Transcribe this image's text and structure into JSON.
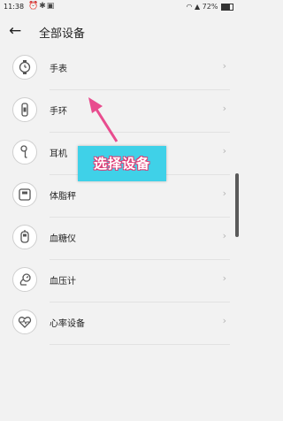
{
  "status_bar": {
    "time": "11:38",
    "right_text": "72%",
    "icons": [
      "alarm-icon",
      "bluetooth-icon",
      "app-notification-icon",
      "wifi-icon",
      "signal-icon",
      "battery-icon"
    ]
  },
  "header": {
    "back_icon": "←",
    "title": "全部设备"
  },
  "devices": [
    {
      "label": "手表",
      "icon": "watch-icon"
    },
    {
      "label": "手环",
      "icon": "band-icon"
    },
    {
      "label": "耳机",
      "icon": "earphone-icon"
    },
    {
      "label": "体脂秤",
      "icon": "scale-icon"
    },
    {
      "label": "血糖仪",
      "icon": "glucose-meter-icon"
    },
    {
      "label": "血压计",
      "icon": "blood-pressure-icon"
    },
    {
      "label": "心率设备",
      "icon": "heart-rate-icon"
    }
  ],
  "chevron": "›",
  "callout": {
    "text": "选择设备"
  },
  "colors": {
    "background": "#f2f2f2",
    "callout": "#3fd1e8",
    "arrow": "#e84c8e"
  }
}
